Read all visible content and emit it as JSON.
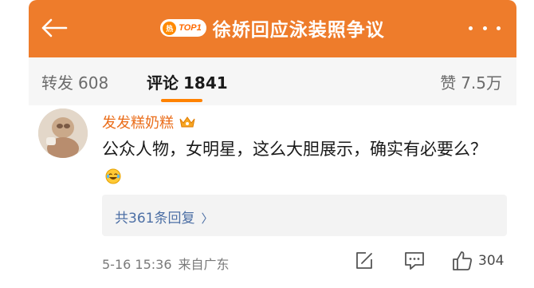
{
  "header": {
    "badge_text": "TOP1",
    "badge_flame_text": "热",
    "title": "徐娇回应泳装照争议",
    "back_icon": "back-arrow-icon",
    "more_icon": "more-dots-icon",
    "bg_color": "#ee7c2b"
  },
  "tabs": {
    "repost_label": "转发",
    "repost_count": "608",
    "comment_label": "评论",
    "comment_count": "1841",
    "like_label": "赞",
    "like_count": "7.5万",
    "active_color": "#ff8200"
  },
  "comment": {
    "username": "发发糕奶糕",
    "username_color": "#ea6d1a",
    "badge_icon": "vip-crown-icon",
    "text": "公众人物，女明星，这么大胆展示，确实有必要么？",
    "emoji_icon": "laugh-tears-emoji-icon",
    "replies_label": "共361条回复",
    "date": "5-16 15:36",
    "source": "来自广东",
    "like_count": "304"
  }
}
